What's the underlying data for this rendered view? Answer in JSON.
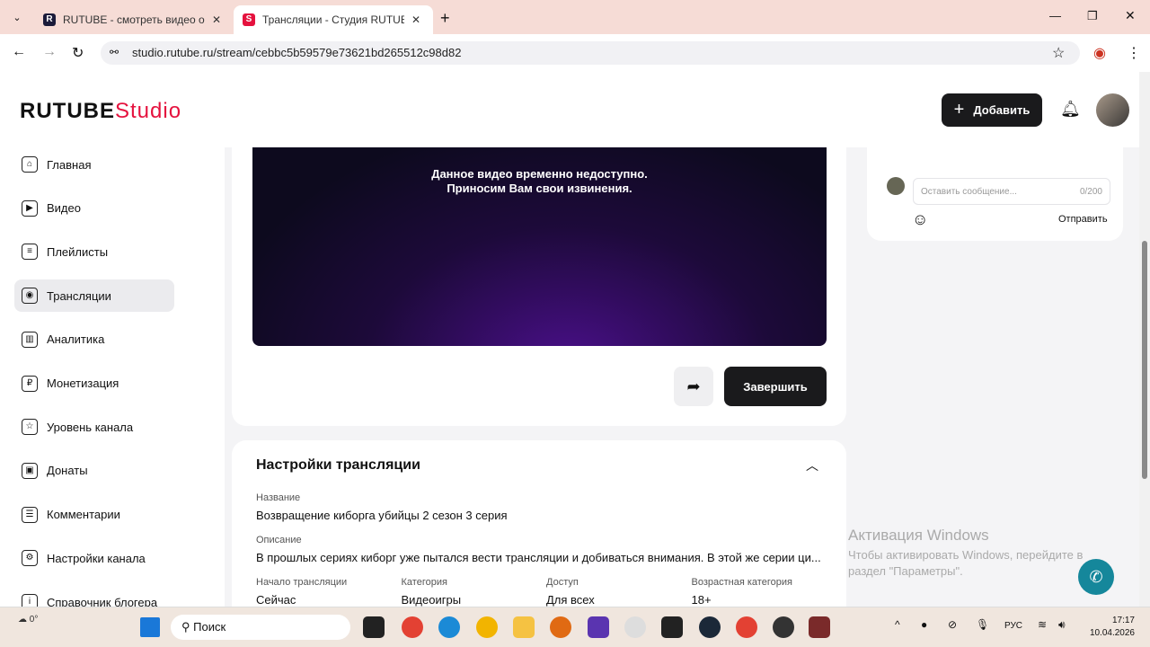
{
  "browser": {
    "tabs": [
      {
        "label": "RUTUBE - смотреть видео онл",
        "icon": "R"
      },
      {
        "label": "Трансляции - Студия RUTUBE",
        "icon": "S"
      }
    ],
    "url": "studio.rutube.ru/stream/cebbc5b59579e73621bd265512c98d82"
  },
  "header": {
    "logo_main": "RUTUBE",
    "logo_studio": "Studio",
    "add_label": "Добавить"
  },
  "sidebar": {
    "items": [
      {
        "label": "Главная",
        "icon": "⌂"
      },
      {
        "label": "Видео",
        "icon": "▶"
      },
      {
        "label": "Плейлисты",
        "icon": "≡"
      },
      {
        "label": "Трансляции",
        "icon": "◉"
      },
      {
        "label": "Аналитика",
        "icon": "▥"
      },
      {
        "label": "Монетизация",
        "icon": "₽"
      },
      {
        "label": "Уровень канала",
        "icon": "☆"
      },
      {
        "label": "Донаты",
        "icon": "▣"
      },
      {
        "label": "Комментарии",
        "icon": "☰"
      },
      {
        "label": "Настройки канала",
        "icon": "⚙"
      },
      {
        "label": "Справочник блогера",
        "icon": "i"
      }
    ]
  },
  "player": {
    "line1": "Данное видео временно недоступно.",
    "line2": "Приносим Вам свои извинения."
  },
  "actions": {
    "finish_label": "Завершить"
  },
  "chat": {
    "placeholder": "Оставить сообщение...",
    "counter": "0/200",
    "send_label": "Отправить"
  },
  "settings": {
    "title": "Настройки трансляции",
    "name_label": "Название",
    "name_value": "Возвращение киборга убийцы 2 сезон 3 серия",
    "desc_label": "Описание",
    "desc_value": "В прошлых сериях киборг уже пытался вести трансляции и добиваться внимания. В этой же серии ци...",
    "fields": [
      {
        "label": "Начало трансляции",
        "value": "Сейчас"
      },
      {
        "label": "Категория",
        "value": "Видеоигры"
      },
      {
        "label": "Доступ",
        "value": "Для всех"
      },
      {
        "label": "Возрастная категория",
        "value": "18+"
      }
    ]
  },
  "watermark": {
    "title": "Активация Windows",
    "text1": "Чтобы активировать Windows, перейдите в",
    "text2": "раздел \"Параметры\"."
  },
  "taskbar": {
    "weather": "0°",
    "search": "Поиск",
    "lang": "РУС",
    "time": "17:17",
    "date": "10.04.2026"
  }
}
